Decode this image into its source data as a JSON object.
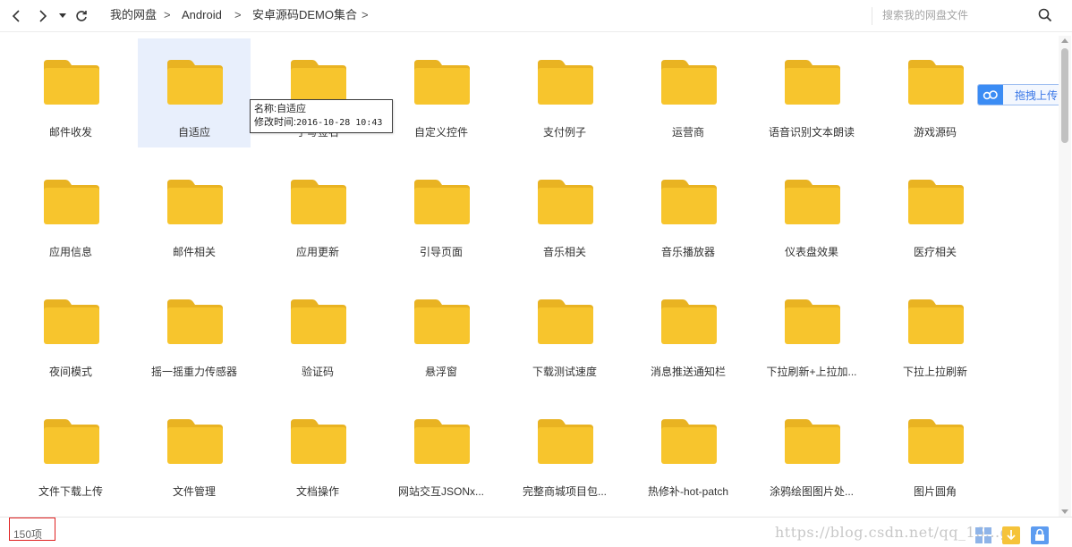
{
  "toolbar": {
    "breadcrumbs": [
      "我的网盘",
      "Android",
      "安卓源码DEMO集合"
    ],
    "separator": ">",
    "search_placeholder": "搜索我的网盘文件"
  },
  "folders": [
    "邮件收发",
    "自适应",
    "手写签名",
    "自定义控件",
    "支付例子",
    "运营商",
    "语音识别文本朗读",
    "游戏源码",
    "应用信息",
    "邮件相关",
    "应用更新",
    "引导页面",
    "音乐相关",
    "音乐播放器",
    "仪表盘效果",
    "医疗相关",
    "夜间模式",
    "摇一摇重力传感器",
    "验证码",
    "悬浮窗",
    "下载测试速度",
    "消息推送通知栏",
    "下拉刷新+上拉加...",
    "下拉上拉刷新",
    "文件下载上传",
    "文件管理",
    "文档操作",
    "网站交互JSONx...",
    "完整商城项目包...",
    "热修补-hot-patch",
    "涂鸦绘图图片处...",
    "图片圆角"
  ],
  "selected_folder_index": 1,
  "tooltip": {
    "name_label": "名称:",
    "name_value": "自适应",
    "time_label": "修改时间:",
    "time_value": "2016-10-28 10:43"
  },
  "upload_button": {
    "label": "拖拽上传"
  },
  "status": {
    "count": "150项"
  },
  "watermark": "https://blog.csdn.net/qq_16...ga",
  "colors": {
    "folder_body": "#f7c52d",
    "folder_tab": "#e9b322",
    "selected_bg": "#e8effc",
    "accent": "#3b8cf4",
    "highlight_border": "#e02020"
  }
}
